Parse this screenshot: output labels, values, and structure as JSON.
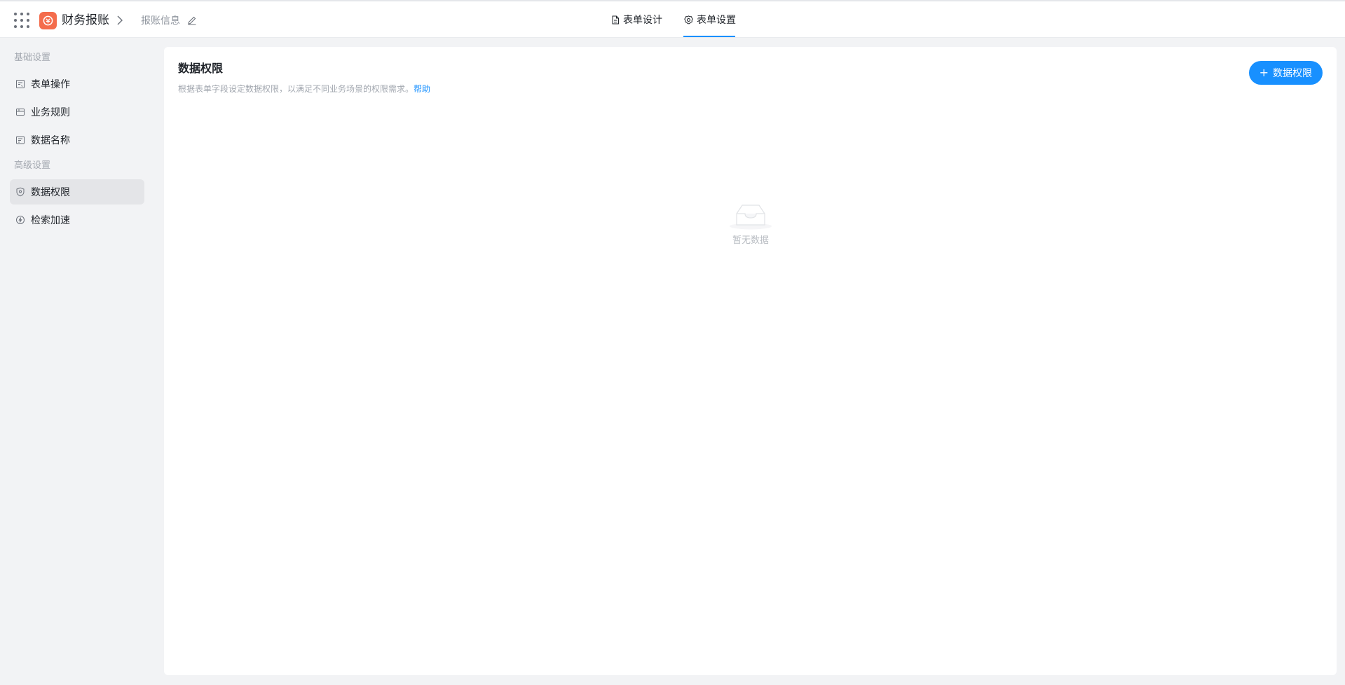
{
  "topbar": {
    "app_name": "财务报账",
    "breadcrumb_current": "报账信息",
    "tabs": [
      {
        "label": "表单设计",
        "icon": "document-icon"
      },
      {
        "label": "表单设置",
        "icon": "gear-icon",
        "active": true
      }
    ],
    "accent_color": "#1890ff",
    "logo_color": "#f46c4c"
  },
  "sidebar": {
    "groups": [
      {
        "title": "基础设置",
        "items": [
          {
            "label": "表单操作",
            "icon": "form-icon"
          },
          {
            "label": "业务规则",
            "icon": "rules-icon"
          },
          {
            "label": "数据名称",
            "icon": "name-icon"
          }
        ]
      },
      {
        "title": "高级设置",
        "items": [
          {
            "label": "数据权限",
            "icon": "shield-icon",
            "active": true
          },
          {
            "label": "检索加速",
            "icon": "lightning-icon"
          }
        ]
      }
    ]
  },
  "main": {
    "title": "数据权限",
    "description": "根据表单字段设定数据权限，以满足不同业务场景的权限需求。",
    "help_label": "帮助",
    "add_button_label": "数据权限",
    "empty_text": "暂无数据"
  }
}
